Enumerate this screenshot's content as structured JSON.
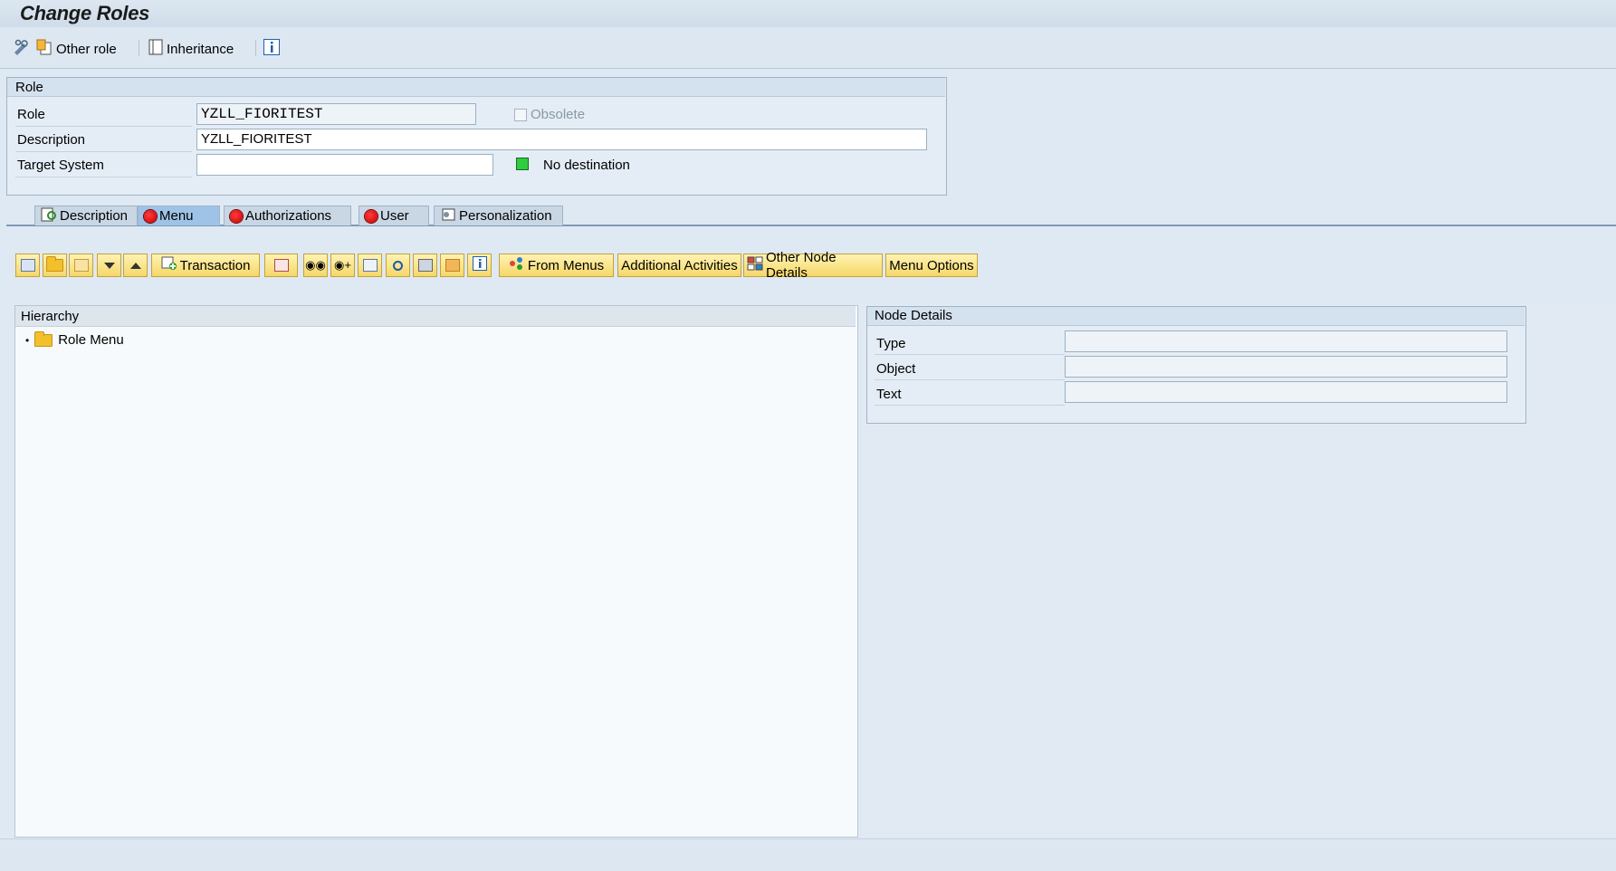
{
  "window": {
    "title": "Change Roles"
  },
  "toolbar": {
    "other_role_label": "Other role",
    "inheritance_label": "Inheritance"
  },
  "role_group": {
    "title": "Role",
    "role_label": "Role",
    "role_value": "YZLL_FIORITEST",
    "obsolete_label": "Obsolete",
    "description_label": "Description",
    "description_value": "YZLL_FIORITEST",
    "target_system_label": "Target System",
    "target_system_value": "",
    "destination_status_text": "No destination",
    "destination_status_color": "#2ecc40"
  },
  "tabs": [
    {
      "label": "Description",
      "icon": "description-icon",
      "active": false
    },
    {
      "label": "Menu",
      "icon": "red-status-icon",
      "active": true
    },
    {
      "label": "Authorizations",
      "icon": "red-status-icon",
      "active": false
    },
    {
      "label": "User",
      "icon": "red-status-icon",
      "active": false
    },
    {
      "label": "Personalization",
      "icon": "personalization-icon",
      "active": false
    }
  ],
  "menu_toolbar": {
    "transaction_label": "Transaction",
    "from_menus_label": "From Menus",
    "additional_activities_label": "Additional Activities",
    "other_node_details_label": "Other Node Details",
    "menu_options_label": "Menu Options"
  },
  "hierarchy": {
    "title": "Hierarchy",
    "nodes": [
      {
        "label": "Role Menu",
        "icon": "folder-icon"
      }
    ]
  },
  "node_details": {
    "title": "Node Details",
    "type_label": "Type",
    "object_label": "Object",
    "text_label": "Text"
  },
  "colors": {
    "accent": "#9ec3e6",
    "button_yellow": "#f6d768",
    "error_red": "#c80000"
  }
}
